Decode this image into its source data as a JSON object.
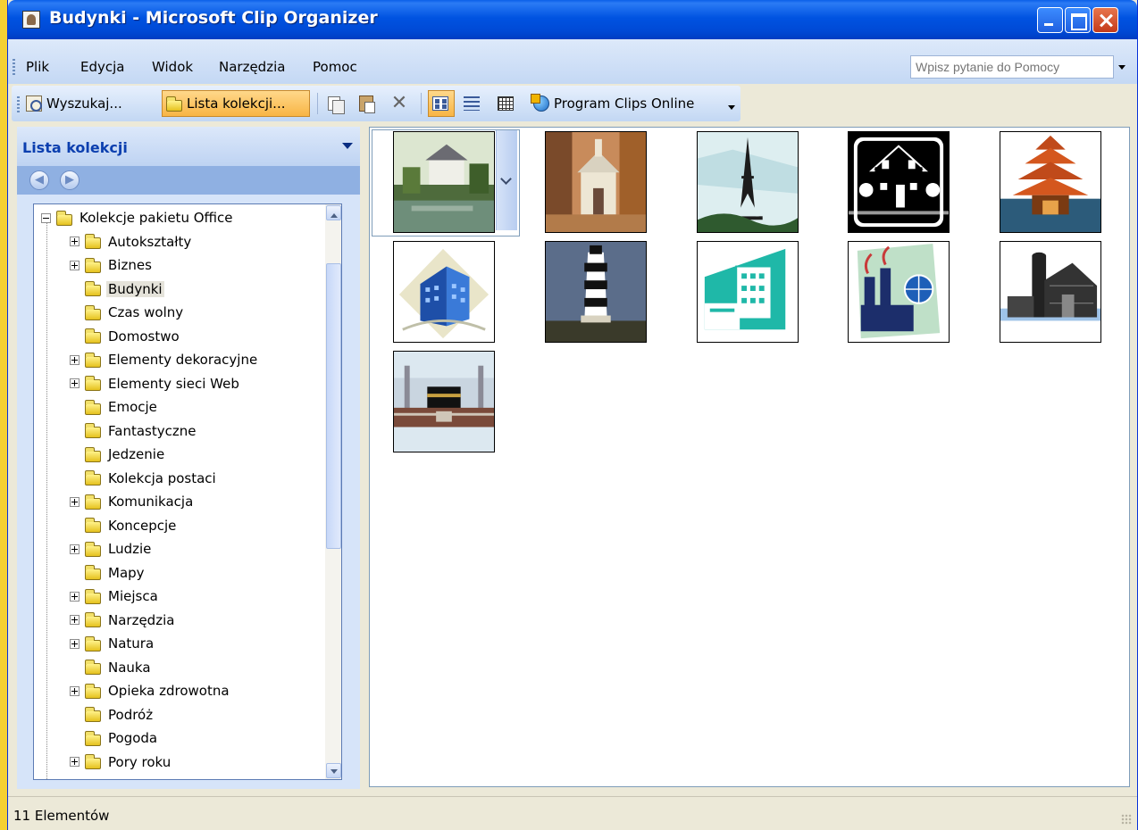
{
  "window": {
    "title": "Budynki - Microsoft Clip Organizer"
  },
  "menubar": {
    "items": [
      "Plik",
      "Edycja",
      "Widok",
      "Narzędzia",
      "Pomoc"
    ],
    "help_placeholder": "Wpisz pytanie do Pomocy"
  },
  "toolbar": {
    "search_label": "Wyszukaj...",
    "collection_list_label": "Lista kolekcji...",
    "clips_online_label": "Program Clips Online"
  },
  "taskpane": {
    "title": "Lista kolekcji",
    "tree": [
      {
        "label": "Kolekcje pakietu Office",
        "expander": "minus",
        "level": 0
      },
      {
        "label": "Autokształty",
        "expander": "plus",
        "level": 1
      },
      {
        "label": "Biznes",
        "expander": "plus",
        "level": 1
      },
      {
        "label": "Budynki",
        "expander": "none",
        "level": 1,
        "selected": true
      },
      {
        "label": "Czas wolny",
        "expander": "none",
        "level": 1
      },
      {
        "label": "Domostwo",
        "expander": "none",
        "level": 1
      },
      {
        "label": "Elementy dekoracyjne",
        "expander": "plus",
        "level": 1
      },
      {
        "label": "Elementy sieci Web",
        "expander": "plus",
        "level": 1
      },
      {
        "label": "Emocje",
        "expander": "none",
        "level": 1
      },
      {
        "label": "Fantastyczne",
        "expander": "none",
        "level": 1
      },
      {
        "label": "Jedzenie",
        "expander": "none",
        "level": 1
      },
      {
        "label": "Kolekcja postaci",
        "expander": "none",
        "level": 1
      },
      {
        "label": "Komunikacja",
        "expander": "plus",
        "level": 1
      },
      {
        "label": "Koncepcje",
        "expander": "none",
        "level": 1
      },
      {
        "label": "Ludzie",
        "expander": "plus",
        "level": 1
      },
      {
        "label": "Mapy",
        "expander": "none",
        "level": 1
      },
      {
        "label": "Miejsca",
        "expander": "plus",
        "level": 1
      },
      {
        "label": "Narzędzia",
        "expander": "plus",
        "level": 1
      },
      {
        "label": "Natura",
        "expander": "plus",
        "level": 1
      },
      {
        "label": "Nauka",
        "expander": "none",
        "level": 1
      },
      {
        "label": "Opieka zdrowotna",
        "expander": "plus",
        "level": 1
      },
      {
        "label": "Podróż",
        "expander": "none",
        "level": 1
      },
      {
        "label": "Pogoda",
        "expander": "none",
        "level": 1
      },
      {
        "label": "Pory roku",
        "expander": "plus",
        "level": 1
      }
    ]
  },
  "gallery": {
    "clips": [
      {
        "icon": "house-by-lake-clip",
        "focused": true
      },
      {
        "icon": "church-autumn-clip"
      },
      {
        "icon": "eiffel-tower-clip"
      },
      {
        "icon": "house-silhouette-clip"
      },
      {
        "icon": "pagoda-clip"
      },
      {
        "icon": "office-tower-clip"
      },
      {
        "icon": "lighthouse-clip"
      },
      {
        "icon": "factory-teal-clip"
      },
      {
        "icon": "factory-globe-clip"
      },
      {
        "icon": "barn-silo-clip"
      },
      {
        "icon": "kaaba-clip"
      }
    ]
  },
  "statusbar": {
    "text": "11 Elementów"
  },
  "colors": {
    "desktop": "#F5D033",
    "titlebar": "#0053E1",
    "toolbar_active": "#F8B545",
    "pane_title": "#0C3FAF"
  }
}
